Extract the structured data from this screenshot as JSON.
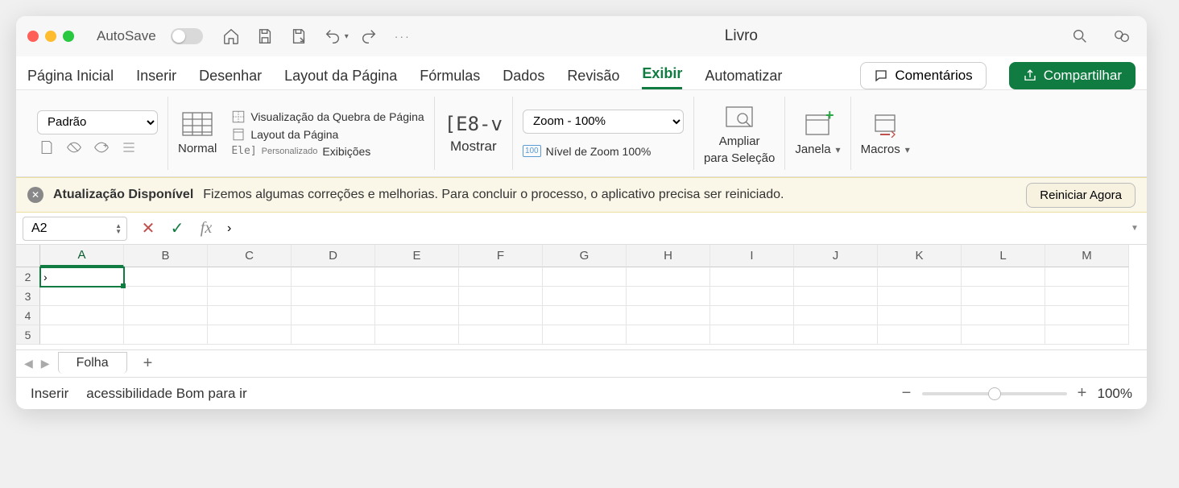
{
  "titlebar": {
    "autosave": "AutoSave",
    "title": "Livro"
  },
  "tabs": {
    "home": "Página Inicial",
    "insert": "Inserir",
    "draw": "Desenhar",
    "pagelayout": "Layout da Página",
    "formulas": "Fórmulas",
    "data": "Dados",
    "review": "Revisão",
    "view": "Exibir",
    "automate": "Automatizar",
    "comments": "Comentários",
    "share": "Compartilhar"
  },
  "ribbon": {
    "view_mode": "Padrão",
    "normal": "Normal",
    "pagebreak": "Visualização da Quebra de Página",
    "pagelayout": "Layout da Página",
    "custom_small": "Personalizado",
    "custom_views": "Exibições",
    "ele": "Ele]",
    "e8v": "[E8-v",
    "show": "Mostrar",
    "zoom_select": "Zoom - 100%",
    "zoom100": "Nível de Zoom 100%",
    "zoom100_badge": "100",
    "zoom_selection_l1": "Ampliar",
    "zoom_selection_l2": "para Seleção",
    "window": "Janela",
    "macros": "Macros"
  },
  "banner": {
    "title": "Atualização Disponível",
    "text": "Fizemos algumas correções e melhorias. Para concluir o processo, o aplicativo precisa ser reiniciado.",
    "button": "Reiniciar Agora"
  },
  "formula": {
    "namebox": "A2",
    "value": "›"
  },
  "grid": {
    "columns": [
      "A",
      "B",
      "C",
      "D",
      "E",
      "F",
      "G",
      "H",
      "I",
      "J",
      "K",
      "L",
      "M"
    ],
    "rows": [
      "2",
      "3",
      "4",
      "5"
    ],
    "active_col": "A",
    "active_row": "2",
    "cells": {
      "A2": "›"
    }
  },
  "sheet": {
    "name": "Folha"
  },
  "status": {
    "mode": "Inserir",
    "accessibility": "acessibilidade Bom para ir",
    "zoom": "100%"
  }
}
